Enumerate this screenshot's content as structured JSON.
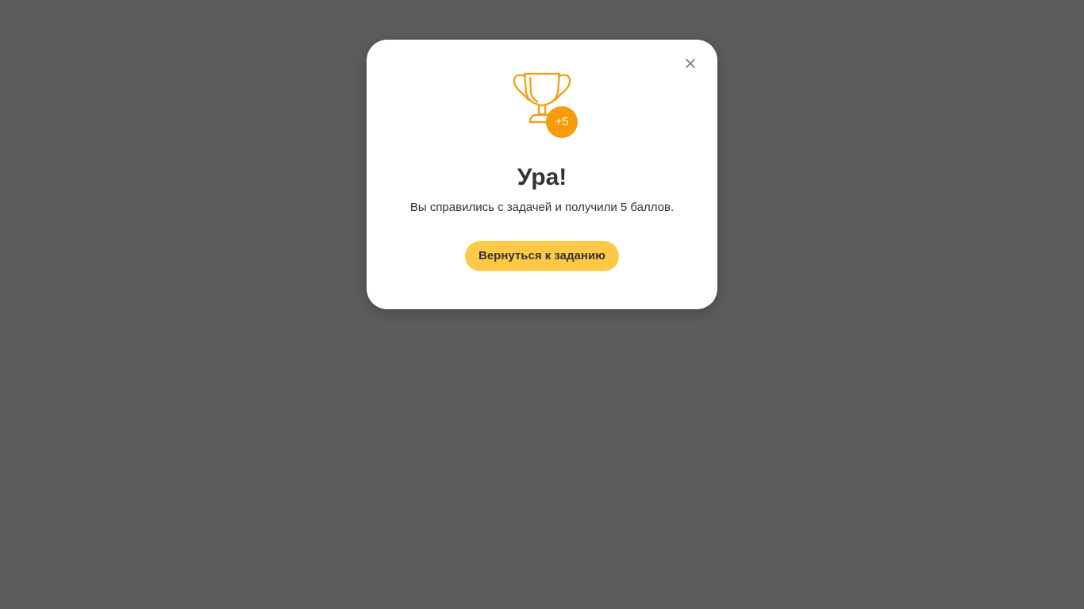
{
  "modal": {
    "title": "Ура!",
    "message": "Вы справились с задачей и получили 5 баллов.",
    "return_button_label": "Вернуться к заданию",
    "points_badge": "+5",
    "icons": {
      "trophy": "trophy-icon",
      "close": "close-icon"
    }
  },
  "colors": {
    "overlay": "#5d5d5d",
    "trophy": "#f59c09",
    "badge": "#f59c09",
    "button": "#ffc945"
  }
}
